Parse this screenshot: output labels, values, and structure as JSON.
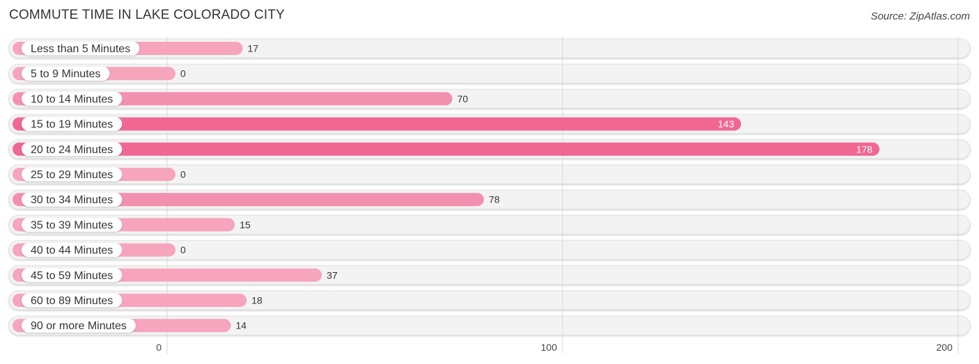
{
  "header": {
    "title": "COMMUTE TIME IN LAKE COLORADO CITY",
    "source": "Source: ZipAtlas.com"
  },
  "colors": {
    "bar_light": "#f6a5bd",
    "bar_medium": "#f490af",
    "bar_dark": "#f06892",
    "track": "#f3f3f3",
    "label_text": "#333333",
    "value_inside": "#ffffff",
    "value_outside": "#333333"
  },
  "chart_data": {
    "type": "bar",
    "orientation": "horizontal",
    "title": "COMMUTE TIME IN LAKE COLORADO CITY",
    "xlabel": "",
    "ylabel": "",
    "categories": [
      "Less than 5 Minutes",
      "5 to 9 Minutes",
      "10 to 14 Minutes",
      "15 to 19 Minutes",
      "20 to 24 Minutes",
      "25 to 29 Minutes",
      "30 to 34 Minutes",
      "35 to 39 Minutes",
      "40 to 44 Minutes",
      "45 to 59 Minutes",
      "60 to 89 Minutes",
      "90 or more Minutes"
    ],
    "values": [
      17,
      0,
      70,
      143,
      178,
      0,
      78,
      15,
      0,
      37,
      18,
      14
    ],
    "xlim": [
      0,
      200
    ],
    "xticks": [
      0,
      100,
      200
    ],
    "xtick_labels": [
      "0",
      "100",
      "200"
    ],
    "grid": true,
    "legend": "none"
  }
}
